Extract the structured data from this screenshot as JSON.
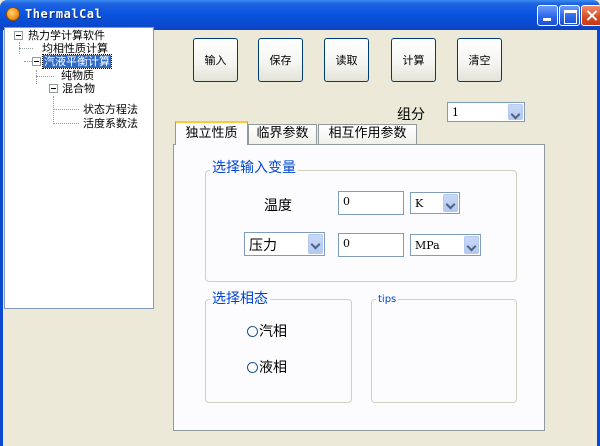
{
  "window": {
    "title": "ThermalCal"
  },
  "tree": {
    "root": "热力学计算软件",
    "uniform": "均相性质计算",
    "vle": "汽液平衡计算",
    "pure": "纯物质",
    "mixture": "混合物",
    "eos": "状态方程法",
    "activity": "活度系数法"
  },
  "toolbar": {
    "input": "输入",
    "save": "保存",
    "read": "读取",
    "calc": "计算",
    "clear": "清空"
  },
  "component": {
    "label": "组分",
    "value": "1"
  },
  "tabs": {
    "independent": "独立性质",
    "critical": "临界参数",
    "interaction": "相互作用参数"
  },
  "input_group": {
    "title": "选择输入变量",
    "temp_label": "温度",
    "temp_value": "0",
    "temp_unit": "K",
    "pressure_select": "压力",
    "pressure_value": "0",
    "pressure_unit": "MPa"
  },
  "phase_group": {
    "title": "选择相态",
    "vapor": "汽相",
    "liquid": "液相"
  },
  "tips": {
    "title": "tips"
  }
}
